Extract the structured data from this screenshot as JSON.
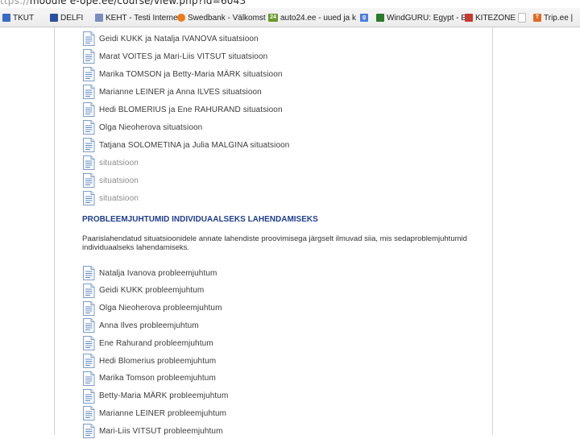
{
  "address_bar": {
    "protocol": "ttps://",
    "rest": "moodle e-ope.ee/course/view.php?id=6043"
  },
  "bookmarks": [
    {
      "label": "TKUT",
      "icon": "tkut-icon",
      "color": "#3a6ac8"
    },
    {
      "label": "DELFI",
      "icon": "delfi-icon",
      "color": "#2b4f9e"
    },
    {
      "label": "KEHT - Testi Internetti",
      "icon": "keht-icon",
      "color": "#7a8dbf"
    },
    {
      "label": "Swedbank - Välkomst",
      "icon": "swedbank-icon",
      "color": "#ee7a1a"
    },
    {
      "label": "auto24.ee - uued ja k",
      "icon": "auto24-icon",
      "color": "#6a9a2a"
    },
    {
      "label": "",
      "icon": "google-icon",
      "color": "#4a7be0"
    },
    {
      "label": "WindGURU: Egypt - E",
      "icon": "windguru-icon",
      "color": "#2a7a2a"
    },
    {
      "label": "KITEZONE",
      "icon": "kitezone-icon",
      "color": "#c83b2e"
    },
    {
      "label": "",
      "icon": "page-icon",
      "color": "#bbbbbb"
    },
    {
      "label": "Trip.ee |",
      "icon": "tripee-icon",
      "color": "#e06a20"
    }
  ],
  "situations": [
    {
      "text": "Geidi KUKK ja Natalja IVANOVA situatsioon",
      "dim": false
    },
    {
      "text": "Marat VOITES ja Mari-Liis VITSUT situatsioon",
      "dim": false
    },
    {
      "text": "Marika TOMSON ja Betty-Maria MÄRK situatsioon",
      "dim": false
    },
    {
      "text": "Marianne LEINER ja Anna ILVES situatsioon",
      "dim": false
    },
    {
      "text": "Hedi BLOMERIUS ja Ene RAHURAND situatsioon",
      "dim": false
    },
    {
      "text": "Olga Nieoherova situatsioon",
      "dim": false
    },
    {
      "text": "Tatjana SOLOMETINA ja Julia MALGINA situatsioon",
      "dim": false
    },
    {
      "text": "situatsioon",
      "dim": true
    },
    {
      "text": "situatsioon",
      "dim": true
    },
    {
      "text": "situatsioon",
      "dim": true
    }
  ],
  "section": {
    "heading": "PROBLEEMJUHTUMID INDIVIDUAALSEKS LAHENDAMISEKS",
    "description": "Paarislahendatud situatsioonidele annate lahendiste proovimisega järgselt ilmuvad siia, mis sedaproblemjuhtumid individuaalseks lahendamiseks."
  },
  "cases": [
    {
      "text": "Natalja Ivanova probleemjuhtum"
    },
    {
      "text": "Geidi KUKK probleemjuhtum"
    },
    {
      "text": "Olga Nieoherova probleemjuhtum"
    },
    {
      "text": "Anna Ilves probleemjuhtum"
    },
    {
      "text": "Ene Rahurand probleemjuhtum"
    },
    {
      "text": "Hedi Blomerius probleemjuhtum"
    },
    {
      "text": "Marika Tomson probleemjuhtum"
    },
    {
      "text": "Betty-Maria MÄRK probleemjuhtum"
    },
    {
      "text": "Marianne LEINER probleemjuhtum"
    },
    {
      "text": "Mari-Liis VITSUT probleemjuhtum"
    }
  ]
}
